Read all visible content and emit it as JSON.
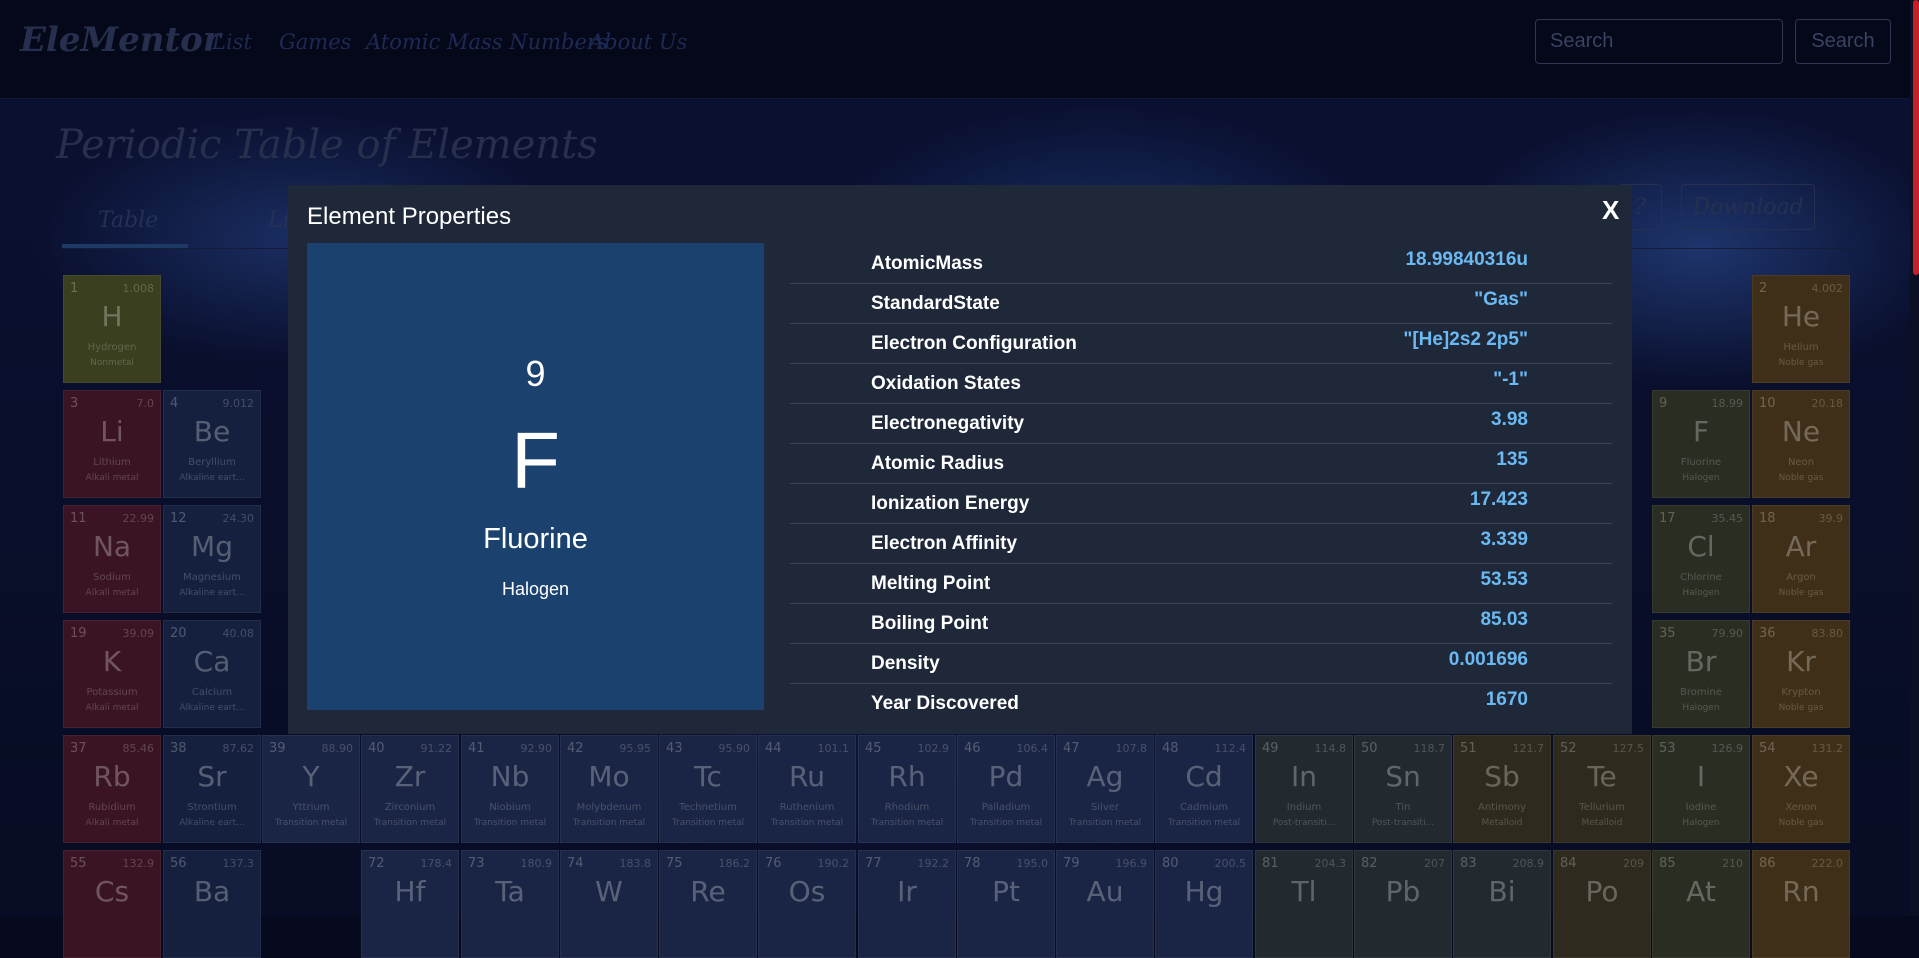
{
  "brand": "EleMentor",
  "nav": [
    "List",
    "Games",
    "Atomic Mass Numbers",
    "About Us"
  ],
  "search": {
    "placeholder": "Search",
    "button": "Search"
  },
  "page_title": "Periodic Table of Elements",
  "tabs": [
    "Table",
    "Li"
  ],
  "action_buttons": {
    "help": "?",
    "download": "Download"
  },
  "tiles": [
    {
      "num": "1",
      "mass": "1.008",
      "sym": "H",
      "name": "Hydrogen",
      "cat": "Nonmetal",
      "color": "#3a3f20"
    },
    {
      "num": "2",
      "mass": "4.002",
      "sym": "He",
      "name": "Helium",
      "cat": "Noble gas",
      "color": "#3f2f18"
    },
    {
      "num": "3",
      "mass": "7.0",
      "sym": "Li",
      "name": "Lithium",
      "cat": "Alkali metal",
      "color": "#3a1424"
    },
    {
      "num": "4",
      "mass": "9.012",
      "sym": "Be",
      "name": "Beryllium",
      "cat": "Alkaline eart...",
      "color": "#15203e"
    },
    {
      "num": "9",
      "mass": "18.99",
      "sym": "F",
      "name": "Fluorine",
      "cat": "Halogen",
      "color": "#2a2e22"
    },
    {
      "num": "10",
      "mass": "20.18",
      "sym": "Ne",
      "name": "Neon",
      "cat": "Noble gas",
      "color": "#3f2f18"
    },
    {
      "num": "11",
      "mass": "22.99",
      "sym": "Na",
      "name": "Sodium",
      "cat": "Alkali metal",
      "color": "#3a1424"
    },
    {
      "num": "12",
      "mass": "24.30",
      "sym": "Mg",
      "name": "Magnesium",
      "cat": "Alkaline eart...",
      "color": "#15203e"
    },
    {
      "num": "17",
      "mass": "35.45",
      "sym": "Cl",
      "name": "Chlorine",
      "cat": "Halogen",
      "color": "#2a2e22"
    },
    {
      "num": "18",
      "mass": "39.9",
      "sym": "Ar",
      "name": "Argon",
      "cat": "Noble gas",
      "color": "#3f2f18"
    },
    {
      "num": "19",
      "mass": "39.09",
      "sym": "K",
      "name": "Potassium",
      "cat": "Alkali metal",
      "color": "#3a1424"
    },
    {
      "num": "20",
      "mass": "40.08",
      "sym": "Ca",
      "name": "Calcium",
      "cat": "Alkaline eart...",
      "color": "#15203e"
    },
    {
      "num": "35",
      "mass": "79.90",
      "sym": "Br",
      "name": "Bromine",
      "cat": "Halogen",
      "color": "#2a2e22"
    },
    {
      "num": "36",
      "mass": "83.80",
      "sym": "Kr",
      "name": "Krypton",
      "cat": "Noble gas",
      "color": "#3f2f18"
    },
    {
      "num": "37",
      "mass": "85.46",
      "sym": "Rb",
      "name": "Rubidium",
      "cat": "Alkali metal",
      "color": "#3a1424"
    },
    {
      "num": "38",
      "mass": "87.62",
      "sym": "Sr",
      "name": "Strontium",
      "cat": "Alkaline eart...",
      "color": "#15203e"
    },
    {
      "num": "39",
      "mass": "88.90",
      "sym": "Y",
      "name": "Yttrium",
      "cat": "Transition metal",
      "color": "#1a2444"
    },
    {
      "num": "40",
      "mass": "91.22",
      "sym": "Zr",
      "name": "Zirconium",
      "cat": "Transition metal",
      "color": "#1a2444"
    },
    {
      "num": "41",
      "mass": "92.90",
      "sym": "Nb",
      "name": "Niobium",
      "cat": "Transition metal",
      "color": "#1a2444"
    },
    {
      "num": "42",
      "mass": "95.95",
      "sym": "Mo",
      "name": "Molybdenum",
      "cat": "Transition metal",
      "color": "#1a2444"
    },
    {
      "num": "43",
      "mass": "95.90",
      "sym": "Tc",
      "name": "Technetium",
      "cat": "Transition metal",
      "color": "#1a2444"
    },
    {
      "num": "44",
      "mass": "101.1",
      "sym": "Ru",
      "name": "Ruthenium",
      "cat": "Transition metal",
      "color": "#1a2444"
    },
    {
      "num": "45",
      "mass": "102.9",
      "sym": "Rh",
      "name": "Rhodium",
      "cat": "Transition metal",
      "color": "#1a2444"
    },
    {
      "num": "46",
      "mass": "106.4",
      "sym": "Pd",
      "name": "Palladium",
      "cat": "Transition metal",
      "color": "#1a2444"
    },
    {
      "num": "47",
      "mass": "107.8",
      "sym": "Ag",
      "name": "Silver",
      "cat": "Transition metal",
      "color": "#1a2444"
    },
    {
      "num": "48",
      "mass": "112.4",
      "sym": "Cd",
      "name": "Cadmium",
      "cat": "Transition metal",
      "color": "#1a2444"
    },
    {
      "num": "49",
      "mass": "114.8",
      "sym": "In",
      "name": "Indium",
      "cat": "Post-transiti...",
      "color": "#222a30"
    },
    {
      "num": "50",
      "mass": "118.7",
      "sym": "Sn",
      "name": "Tin",
      "cat": "Post-transiti...",
      "color": "#222a30"
    },
    {
      "num": "51",
      "mass": "121.7",
      "sym": "Sb",
      "name": "Antimony",
      "cat": "Metalloid",
      "color": "#2e2a1e"
    },
    {
      "num": "52",
      "mass": "127.5",
      "sym": "Te",
      "name": "Tellurium",
      "cat": "Metalloid",
      "color": "#2e2a1e"
    },
    {
      "num": "53",
      "mass": "126.9",
      "sym": "I",
      "name": "Iodine",
      "cat": "Halogen",
      "color": "#2a2e22"
    },
    {
      "num": "54",
      "mass": "131.2",
      "sym": "Xe",
      "name": "Xenon",
      "cat": "Noble gas",
      "color": "#3f2f18"
    },
    {
      "num": "55",
      "mass": "132.9",
      "sym": "Cs",
      "name": "",
      "cat": "",
      "color": "#3a1424"
    },
    {
      "num": "56",
      "mass": "137.3",
      "sym": "Ba",
      "name": "",
      "cat": "",
      "color": "#15203e"
    },
    {
      "num": "72",
      "mass": "178.4",
      "sym": "Hf",
      "name": "",
      "cat": "",
      "color": "#1a2444"
    },
    {
      "num": "73",
      "mass": "180.9",
      "sym": "Ta",
      "name": "",
      "cat": "",
      "color": "#1a2444"
    },
    {
      "num": "74",
      "mass": "183.8",
      "sym": "W",
      "name": "",
      "cat": "",
      "color": "#1a2444"
    },
    {
      "num": "75",
      "mass": "186.2",
      "sym": "Re",
      "name": "",
      "cat": "",
      "color": "#1a2444"
    },
    {
      "num": "76",
      "mass": "190.2",
      "sym": "Os",
      "name": "",
      "cat": "",
      "color": "#1a2444"
    },
    {
      "num": "77",
      "mass": "192.2",
      "sym": "Ir",
      "name": "",
      "cat": "",
      "color": "#1a2444"
    },
    {
      "num": "78",
      "mass": "195.0",
      "sym": "Pt",
      "name": "",
      "cat": "",
      "color": "#1a2444"
    },
    {
      "num": "79",
      "mass": "196.9",
      "sym": "Au",
      "name": "",
      "cat": "",
      "color": "#1a2444"
    },
    {
      "num": "80",
      "mass": "200.5",
      "sym": "Hg",
      "name": "",
      "cat": "",
      "color": "#1a2444"
    },
    {
      "num": "81",
      "mass": "204.3",
      "sym": "Tl",
      "name": "",
      "cat": "",
      "color": "#222a30"
    },
    {
      "num": "82",
      "mass": "207",
      "sym": "Pb",
      "name": "",
      "cat": "",
      "color": "#222a30"
    },
    {
      "num": "83",
      "mass": "208.9",
      "sym": "Bi",
      "name": "",
      "cat": "",
      "color": "#222a30"
    },
    {
      "num": "84",
      "mass": "209",
      "sym": "Po",
      "name": "",
      "cat": "",
      "color": "#2e2a1e"
    },
    {
      "num": "85",
      "mass": "210",
      "sym": "At",
      "name": "",
      "cat": "",
      "color": "#2a2e22"
    },
    {
      "num": "86",
      "mass": "222.0",
      "sym": "Rn",
      "name": "",
      "cat": "",
      "color": "#3f2f18"
    }
  ],
  "modal": {
    "title": "Element Properties",
    "close": "X",
    "element": {
      "number": "9",
      "symbol": "F",
      "name": "Fluorine",
      "category": "Halogen",
      "color": "#1b426f"
    },
    "properties": [
      {
        "label": "AtomicMass",
        "value": "18.99840316u"
      },
      {
        "label": "StandardState",
        "value": "\"Gas\""
      },
      {
        "label": "Electron Configuration",
        "value": "\"[He]2s2 2p5\""
      },
      {
        "label": "Oxidation States",
        "value": "\"-1\""
      },
      {
        "label": "Electronegativity",
        "value": "3.98"
      },
      {
        "label": "Atomic Radius",
        "value": "135"
      },
      {
        "label": "Ionization Energy",
        "value": "17.423"
      },
      {
        "label": "Electron Affinity",
        "value": "3.339"
      },
      {
        "label": "Melting Point",
        "value": "53.53"
      },
      {
        "label": "Boiling Point",
        "value": "85.03"
      },
      {
        "label": "Density",
        "value": "0.001696"
      },
      {
        "label": "Year Discovered",
        "value": "1670"
      }
    ]
  }
}
